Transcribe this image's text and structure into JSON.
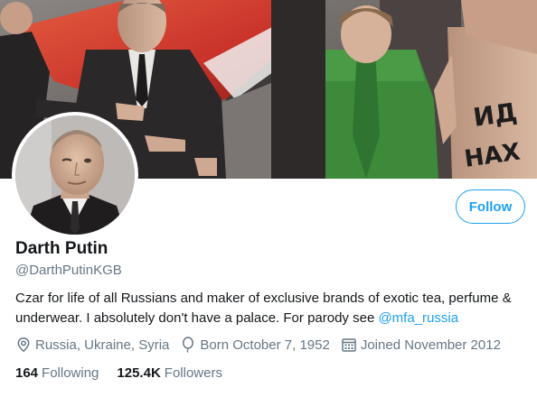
{
  "profile": {
    "display_name": "Darth Putin",
    "handle": "@DarthPutinKGB",
    "bio_text": "Czar for life of all Russians and maker of exclusive brands of exotic tea, perfume & underwear. I absolutely don't have a palace. For parody see ",
    "bio_link": "@mfa_russia",
    "follow_label": "Follow"
  },
  "meta": {
    "location": "Russia, Ukraine, Syria",
    "birthday": "Born October 7, 1952",
    "joined": "Joined November 2012"
  },
  "stats": {
    "following_count": "164",
    "following_label": "Following",
    "followers_count": "125.4K",
    "followers_label": "Followers"
  },
  "banner": {
    "protest_text_line1": "ИД",
    "protest_text_line2": "НАХ"
  },
  "colors": {
    "accent": "#1da1f2",
    "text_primary": "#14171a",
    "text_secondary": "#657786",
    "coat_green": "#3c8a3a"
  }
}
